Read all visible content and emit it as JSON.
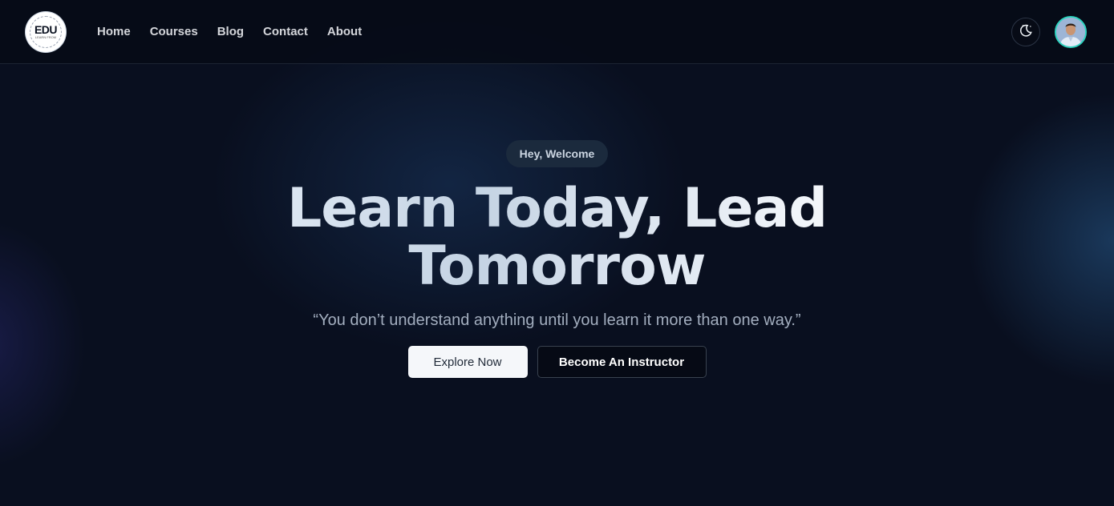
{
  "header": {
    "logo": {
      "text": "EDU",
      "sub": "LEARN FROM"
    },
    "nav": [
      {
        "label": "Home"
      },
      {
        "label": "Courses"
      },
      {
        "label": "Blog"
      },
      {
        "label": "Contact"
      },
      {
        "label": "About"
      }
    ],
    "theme_toggle_icon": "moon-stars-icon",
    "avatar_icon": "user-avatar"
  },
  "hero": {
    "badge": "Hey, Welcome",
    "title_line1": "Learn Today, Lead",
    "title_line2": "Tomorrow",
    "quote": "“You don’t understand anything until you learn it more than one way.”",
    "primary_button": "Explore Now",
    "secondary_button": "Become An Instructor"
  },
  "colors": {
    "background": "#090f1f",
    "accent_avatar_border": "#2dd4bf",
    "badge_bg": "#1b2a3d",
    "primary_button_bg": "#f5f7fa",
    "secondary_button_bg": "#060a15"
  }
}
